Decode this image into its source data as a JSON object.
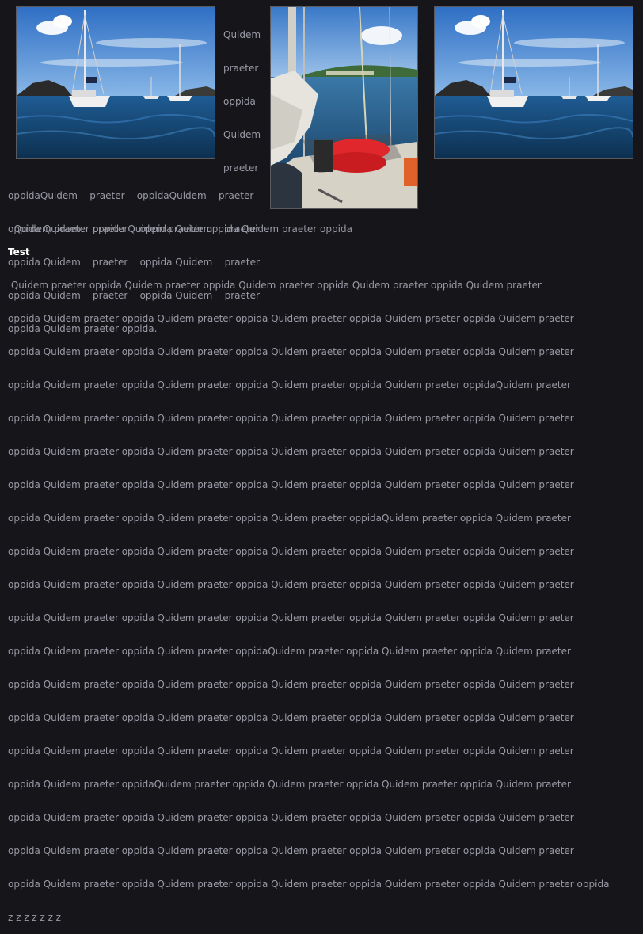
{
  "images": {
    "left": {
      "alt": "sailboat-photo",
      "icon": "sailboat-image"
    },
    "middle": {
      "alt": "sailboat-deck-photo",
      "icon": "sailboat-deck-image"
    },
    "right": {
      "alt": "sailboat-photo",
      "icon": "sailboat-image"
    }
  },
  "caption_column": {
    "lines": [
      "Quidem",
      "praeter",
      "oppida",
      "Quidem",
      "praeter"
    ]
  },
  "wrap_text": {
    "lines": [
      "oppidaQuidem    praeter    oppidaQuidem    praeter",
      "oppida Quidem    praeter    oppida Quidem    praeter",
      "oppida Quidem    praeter    oppida Quidem    praeter",
      "oppida Quidem    praeter    oppida Quidem    praeter",
      "oppida Quidem praeter oppida."
    ]
  },
  "wide_line": "  Quidem praeter oppida Quidem praeter oppida Quidem praeter oppida",
  "section": {
    "heading": "Test",
    "lines": [
      " Quidem praeter oppida Quidem praeter oppida Quidem praeter oppida Quidem praeter oppida Quidem praeter",
      "oppida Quidem praeter oppida Quidem praeter oppida Quidem praeter oppida Quidem praeter oppida Quidem praeter",
      "oppida Quidem praeter oppida Quidem praeter oppida Quidem praeter oppida Quidem praeter oppida Quidem praeter",
      "oppida Quidem praeter oppida Quidem praeter oppida Quidem praeter oppida Quidem praeter oppidaQuidem praeter",
      "oppida Quidem praeter oppida Quidem praeter oppida Quidem praeter oppida Quidem praeter oppida Quidem praeter",
      "oppida Quidem praeter oppida Quidem praeter oppida Quidem praeter oppida Quidem praeter oppida Quidem praeter",
      "oppida Quidem praeter oppida Quidem praeter oppida Quidem praeter oppida Quidem praeter oppida Quidem praeter",
      "oppida Quidem praeter oppida Quidem praeter oppida Quidem praeter oppidaQuidem praeter oppida Quidem praeter",
      "oppida Quidem praeter oppida Quidem praeter oppida Quidem praeter oppida Quidem praeter oppida Quidem praeter",
      "oppida Quidem praeter oppida Quidem praeter oppida Quidem praeter oppida Quidem praeter oppida Quidem praeter",
      "oppida Quidem praeter oppida Quidem praeter oppida Quidem praeter oppida Quidem praeter oppida Quidem praeter",
      "oppida Quidem praeter oppida Quidem praeter oppidaQuidem praeter oppida Quidem praeter oppida Quidem praeter",
      "oppida Quidem praeter oppida Quidem praeter oppida Quidem praeter oppida Quidem praeter oppida Quidem praeter",
      "oppida Quidem praeter oppida Quidem praeter oppida Quidem praeter oppida Quidem praeter oppida Quidem praeter",
      "oppida Quidem praeter oppida Quidem praeter oppida Quidem praeter oppida Quidem praeter oppida Quidem praeter",
      "oppida Quidem praeter oppidaQuidem praeter oppida Quidem praeter oppida Quidem praeter oppida Quidem praeter",
      "oppida Quidem praeter oppida Quidem praeter oppida Quidem praeter oppida Quidem praeter oppida Quidem praeter",
      "oppida Quidem praeter oppida Quidem praeter oppida Quidem praeter oppida Quidem praeter oppida Quidem praeter",
      "oppida Quidem praeter oppida Quidem praeter oppida Quidem praeter oppida Quidem praeter oppida Quidem praeter oppida",
      "z z z z z z z"
    ]
  }
}
